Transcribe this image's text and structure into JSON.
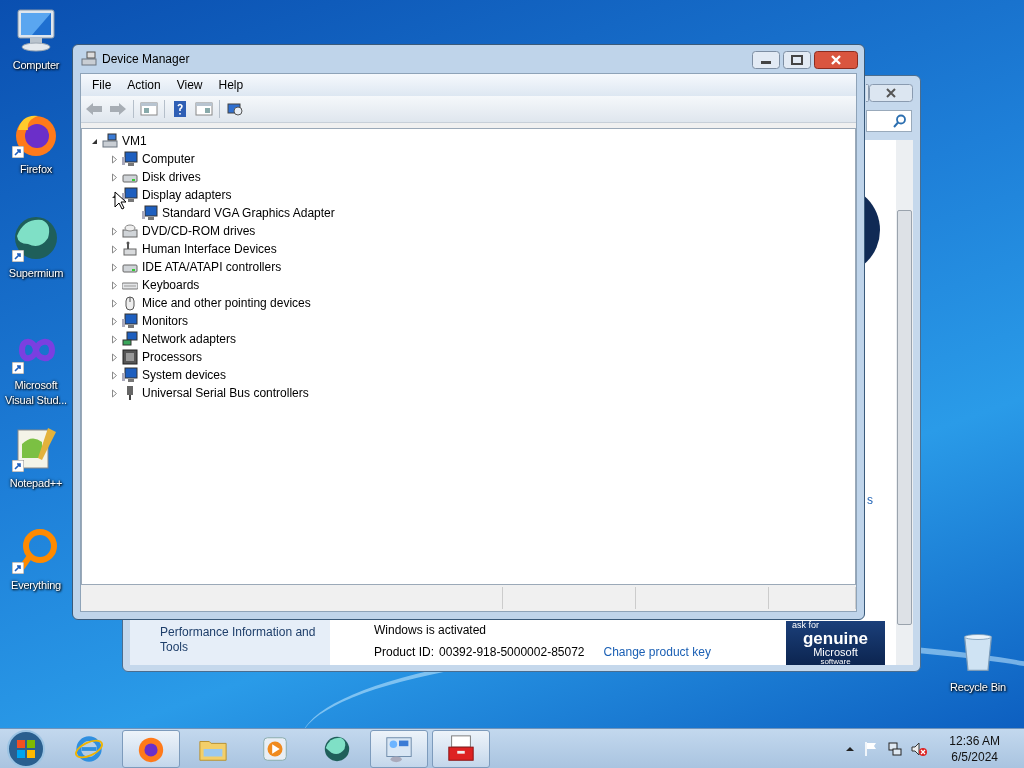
{
  "desktop_icons": [
    {
      "label": "Computer",
      "kind": "computer",
      "shortcut": false
    },
    {
      "label": "Firefox",
      "kind": "firefox",
      "shortcut": true
    },
    {
      "label": "Supermium",
      "kind": "supermium",
      "shortcut": true
    },
    {
      "label": "Microsoft Visual Stud...",
      "kind": "visualstudio",
      "shortcut": true
    },
    {
      "label": "Notepad++",
      "kind": "notepad",
      "shortcut": true
    },
    {
      "label": "Everything",
      "kind": "everything",
      "shortcut": true
    }
  ],
  "recycle_bin": {
    "label": "Recycle Bin"
  },
  "background_window": {
    "sidebar_link": "Performance Information and Tools",
    "activation_status": "Windows is activated",
    "product_id_label": "Product ID:",
    "product_id": "00392-918-5000002-85072",
    "change_key_link": "Change product key",
    "cut_link": "s",
    "genuine_badge": {
      "line_1": "ask for",
      "line_2": "genuine",
      "line_3": "Microsoft",
      "line_4": "software"
    }
  },
  "device_manager": {
    "title": "Device Manager",
    "menu": [
      "File",
      "Action",
      "View",
      "Help"
    ],
    "tree": {
      "label": "VM1",
      "kind": "computer",
      "expanded": true,
      "children": [
        {
          "label": "Computer",
          "kind": "monitor",
          "expanded": false
        },
        {
          "label": "Disk drives",
          "kind": "drive",
          "expanded": false
        },
        {
          "label": "Display adapters",
          "kind": "display",
          "expanded": true,
          "children": [
            {
              "label": "Standard VGA Graphics Adapter",
              "kind": "display"
            }
          ]
        },
        {
          "label": "DVD/CD-ROM drives",
          "kind": "dvd",
          "expanded": false
        },
        {
          "label": "Human Interface Devices",
          "kind": "hid",
          "expanded": false
        },
        {
          "label": "IDE ATA/ATAPI controllers",
          "kind": "ide",
          "expanded": false
        },
        {
          "label": "Keyboards",
          "kind": "keyboard",
          "expanded": false
        },
        {
          "label": "Mice and other pointing devices",
          "kind": "mouse",
          "expanded": false
        },
        {
          "label": "Monitors",
          "kind": "monitor",
          "expanded": false
        },
        {
          "label": "Network adapters",
          "kind": "network",
          "expanded": false
        },
        {
          "label": "Processors",
          "kind": "chip",
          "expanded": false
        },
        {
          "label": "System devices",
          "kind": "monitor",
          "expanded": false
        },
        {
          "label": "Universal Serial Bus controllers",
          "kind": "usb",
          "expanded": false
        }
      ]
    }
  },
  "taskbar": {
    "items": [
      {
        "kind": "ie",
        "open": false
      },
      {
        "kind": "firefox",
        "open": true
      },
      {
        "kind": "explorer",
        "open": false
      },
      {
        "kind": "mediaplayer",
        "open": false
      },
      {
        "kind": "supermium",
        "open": false
      },
      {
        "kind": "controlpanel",
        "open": true
      },
      {
        "kind": "devicemanager",
        "open": true
      }
    ],
    "clock": {
      "time": "12:36 AM",
      "date": "6/5/2024"
    }
  }
}
